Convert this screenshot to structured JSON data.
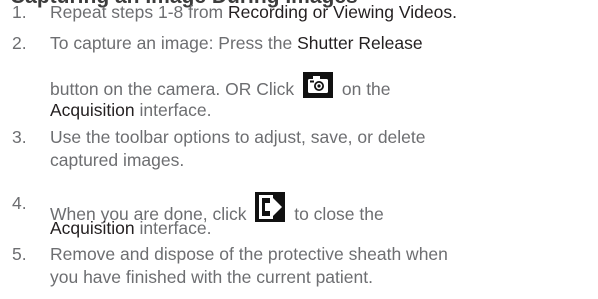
{
  "heading": {
    "text": "Capturing an Image During Images"
  },
  "steps": [
    {
      "number": "1.",
      "before": "Repeat steps 1-8 from ",
      "link": "Recording or Viewing Videos."
    },
    {
      "number": "2.",
      "line1_before": "To capture an image: Press the ",
      "line1_highlight": "Shutter Release",
      "line2_before": "button on the camera. OR Click ",
      "line2_after": " on the",
      "line3_highlight": "Acquisition",
      "line3_after": " interface.",
      "icon": "camera-icon"
    },
    {
      "number": "3.",
      "line1": "Use the toolbar options to adjust, save, or delete",
      "line2": "captured images."
    },
    {
      "number": "4.",
      "line1_before": "When you are done, click ",
      "line1_after": " to close the",
      "line2_highlight": "Acquisition",
      "line2_after": " interface.",
      "icon": "exit-icon"
    },
    {
      "number": "5.",
      "line1": "Remove and dispose of the protective sheath when",
      "line2": "you have finished with the current patient."
    }
  ]
}
